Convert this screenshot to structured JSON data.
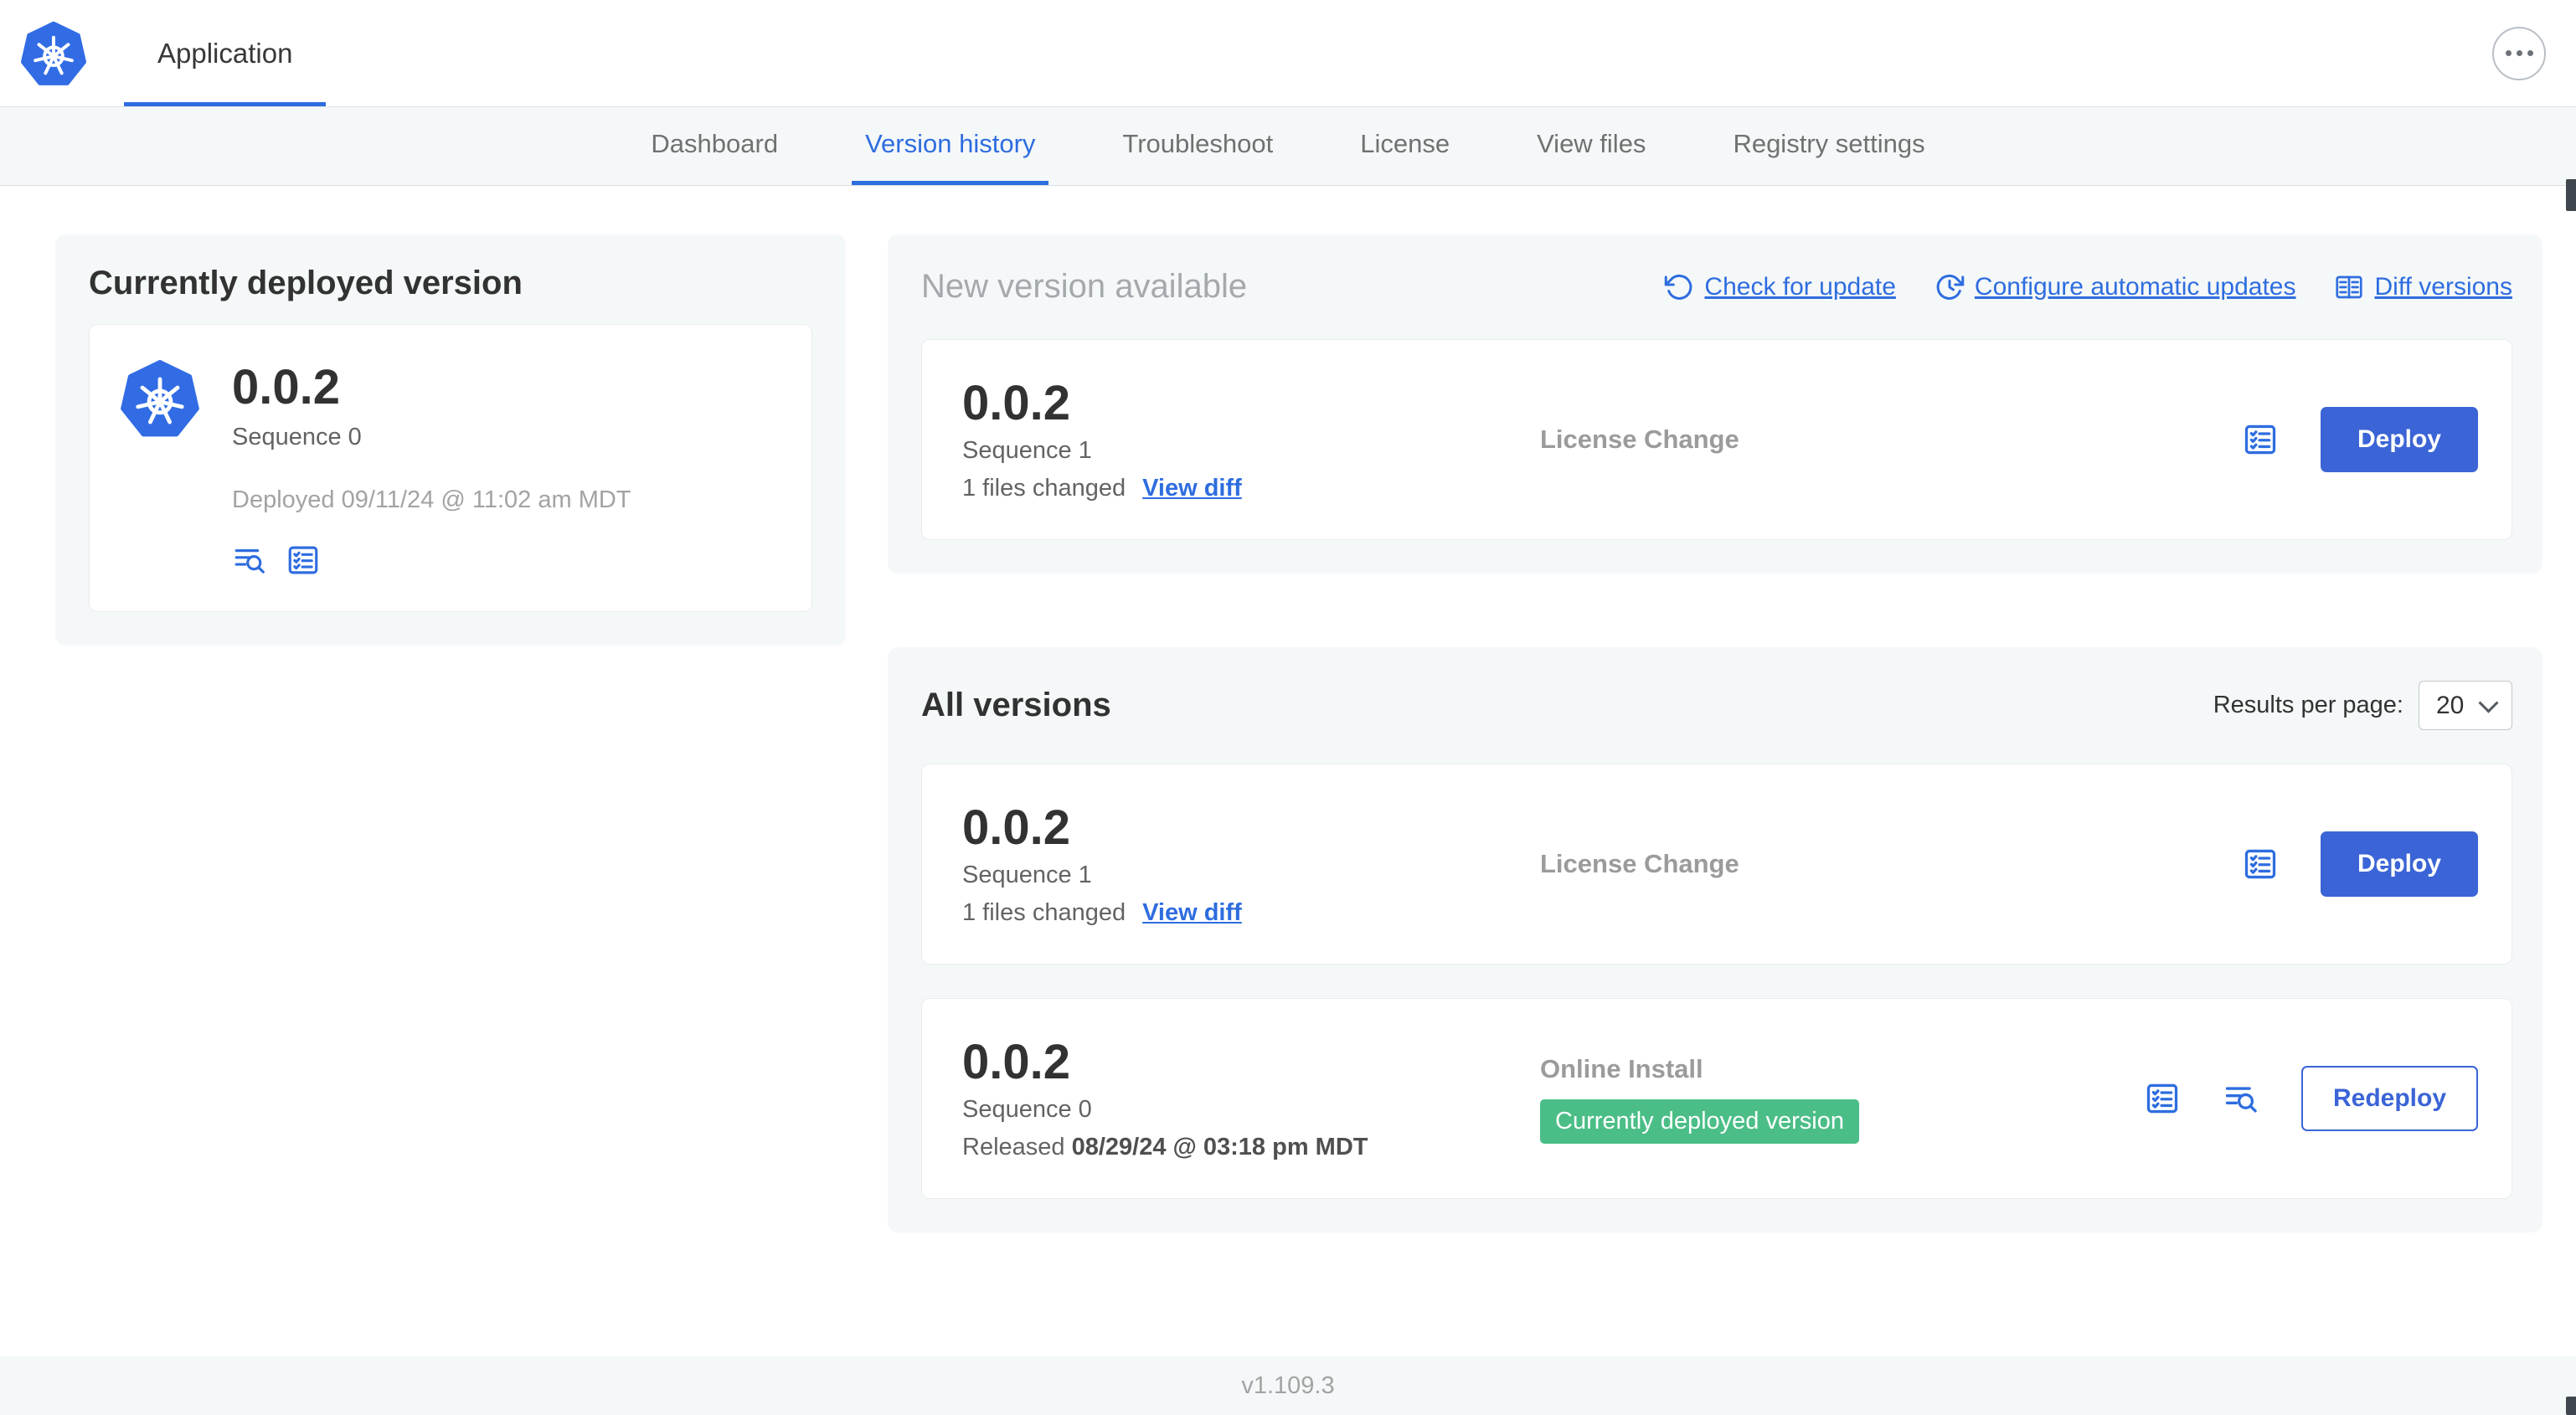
{
  "header": {
    "app_label": "Application"
  },
  "nav": {
    "tabs": [
      {
        "label": "Dashboard"
      },
      {
        "label": "Version history"
      },
      {
        "label": "Troubleshoot"
      },
      {
        "label": "License"
      },
      {
        "label": "View files"
      },
      {
        "label": "Registry settings"
      }
    ],
    "active_tab": "Version history"
  },
  "current": {
    "title": "Currently deployed version",
    "version": "0.0.2",
    "sequence": "Sequence 0",
    "deployed": "Deployed 09/11/24 @ 11:02 am MDT"
  },
  "new_version": {
    "title": "New version available",
    "actions": [
      {
        "label": "Check for update",
        "icon": "refresh-icon"
      },
      {
        "label": "Configure automatic updates",
        "icon": "auto-update-clock-icon"
      },
      {
        "label": "Diff versions",
        "icon": "diff-icon"
      }
    ],
    "row": {
      "version": "0.0.2",
      "sequence": "Sequence 1",
      "files_changed": "1 files changed",
      "view_diff_label": "View diff",
      "source": "License Change",
      "deploy_label": "Deploy"
    }
  },
  "all_versions": {
    "title": "All versions",
    "results_per_page_label": "Results per page:",
    "results_per_page_value": "20",
    "rows": [
      {
        "version": "0.0.2",
        "sequence": "Sequence 1",
        "files_changed": "1 files changed",
        "view_diff_label": "View diff",
        "source": "License Change",
        "action_label": "Deploy"
      },
      {
        "version": "0.0.2",
        "sequence": "Sequence 0",
        "released_prefix": "Released",
        "released_date": "08/29/24 @ 03:18 pm MDT",
        "source": "Online Install",
        "badge": "Currently deployed version",
        "action_label": "Redeploy"
      }
    ]
  },
  "footer": {
    "app_version": "v1.109.3"
  },
  "icons": {
    "app_logo": "kubernetes-helm-icon",
    "more_options": "ellipsis-icon",
    "check_for_update": "refresh-ccw-icon",
    "configure_automatic_updates": "clock-refresh-icon",
    "diff_versions": "diff-table-icon",
    "preflight_checks": "checklist-icon",
    "view_logs": "lines-magnifier-icon"
  },
  "colors": {
    "accent_blue": "#2e6ddf",
    "button_blue": "#3b64d6",
    "badge_green": "#4bbe87",
    "muted_gray": "#9b9b9b",
    "card_bg": "#f5f8f9",
    "kubernetes_blue": "#326ce5"
  }
}
